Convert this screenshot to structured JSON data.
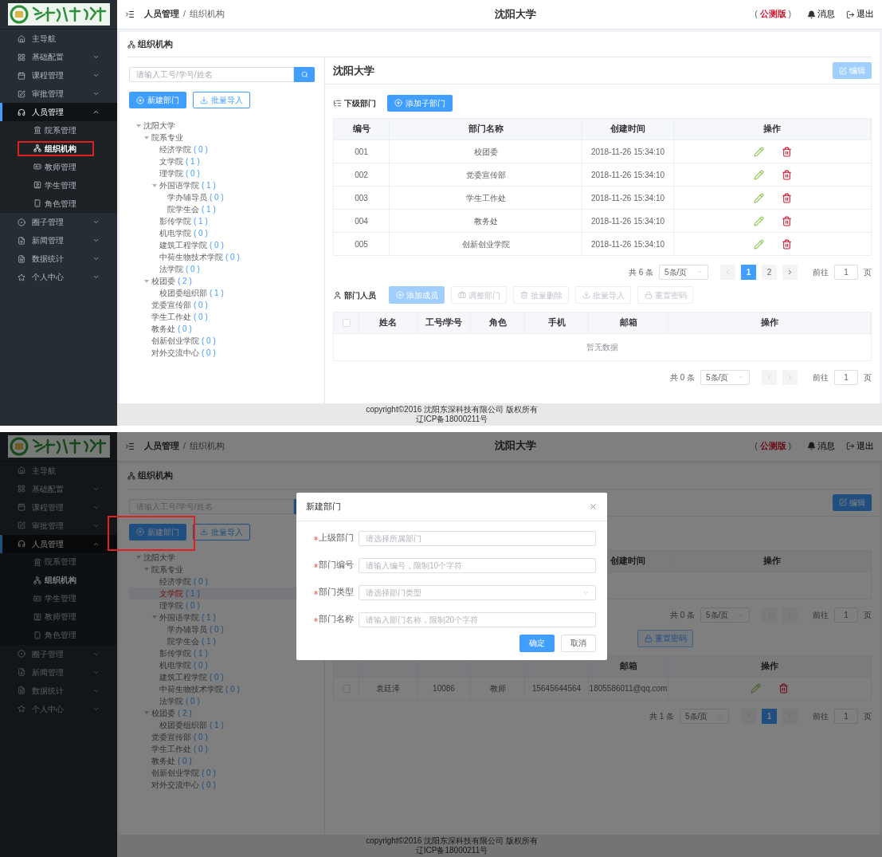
{
  "screens": [
    {
      "sidebar": {
        "items": [
          {
            "label": "主导航",
            "kind": "link",
            "expanded": false
          },
          {
            "label": "基础配置",
            "kind": "submenu",
            "expanded": false
          },
          {
            "label": "课程管理",
            "kind": "submenu",
            "expanded": false
          },
          {
            "label": "审批管理",
            "kind": "submenu",
            "expanded": false
          },
          {
            "label": "人员管理",
            "kind": "submenu",
            "expanded": true,
            "children": [
              {
                "label": "院系管理",
                "selected": false,
                "annotated": false
              },
              {
                "label": "组织机构",
                "selected": true,
                "annotated": true
              },
              {
                "label": "教师管理",
                "selected": false,
                "annotated": false
              },
              {
                "label": "学生管理",
                "selected": false,
                "annotated": false
              },
              {
                "label": "角色管理",
                "selected": false,
                "annotated": false
              }
            ]
          },
          {
            "label": "圈子管理",
            "kind": "submenu",
            "expanded": false
          },
          {
            "label": "新闻管理",
            "kind": "submenu",
            "expanded": false
          },
          {
            "label": "数据统计",
            "kind": "submenu",
            "expanded": false
          },
          {
            "label": "个人中心",
            "kind": "submenu",
            "expanded": false
          }
        ]
      },
      "header": {
        "breadcrumb": [
          "人员管理",
          "组织机构"
        ],
        "separator": "/",
        "title": "沈阳大学",
        "edition": "( **公测版** )",
        "messages": "消息",
        "logout": "退出"
      },
      "card_title": "组织机构",
      "search": {
        "placeholder": "请输入工号/学号/姓名"
      },
      "left_buttons": [
        {
          "label": "新建部门",
          "kind": "primary",
          "annotated": false
        },
        {
          "label": "批量导入",
          "kind": "default",
          "annotated": false
        }
      ],
      "tree": [
        {
          "name": "沈阳大学",
          "expanded": true,
          "selected": false,
          "children": [
            {
              "name": "院系专业",
              "expanded": true,
              "selected": false,
              "children": [
                {
                  "name": "经济学院",
                  "count": "( 0 )",
                  "selected": false
                },
                {
                  "name": "文学院",
                  "count": "( 1 )",
                  "selected": false
                },
                {
                  "name": "理学院",
                  "count": "( 0 )",
                  "selected": false
                },
                {
                  "name": "外国语学院",
                  "count": "( 1 )",
                  "expanded": true,
                  "selected": false,
                  "children": [
                    {
                      "name": "学办辅导员",
                      "count": "( 0 )",
                      "selected": false
                    },
                    {
                      "name": "院学生会",
                      "count": "( 1 )",
                      "selected": false
                    }
                  ]
                },
                {
                  "name": "影传学院",
                  "count": "( 1 )",
                  "selected": false
                },
                {
                  "name": "机电学院",
                  "count": "( 0 )",
                  "selected": false
                },
                {
                  "name": "建筑工程学院",
                  "count": "( 0 )",
                  "selected": false
                },
                {
                  "name": "中荷生物技术学院",
                  "count": "( 0 )",
                  "selected": false
                },
                {
                  "name": "法学院",
                  "count": "( 0 )",
                  "selected": false
                }
              ]
            },
            {
              "name": "校团委",
              "count": "( 2 )",
              "expanded": true,
              "selected": false,
              "children": [
                {
                  "name": "校团委组织部",
                  "count": "( 1 )",
                  "selected": false
                }
              ]
            },
            {
              "name": "党委宣传部",
              "count": "( 0 )",
              "selected": false
            },
            {
              "name": "学生工作处",
              "count": "( 0 )",
              "selected": false
            },
            {
              "name": "教务处",
              "count": "( 0 )",
              "selected": false
            },
            {
              "name": "创新创业学院",
              "count": "( 0 )",
              "selected": false
            },
            {
              "name": "对外交流中心",
              "count": "( 0 )",
              "selected": false
            }
          ]
        }
      ],
      "detail": {
        "title": "沈阳大学",
        "edit_button": {
          "label": "编辑",
          "disabled": true
        },
        "sub_label": "下级部门",
        "add_button": "添加子部门",
        "sub_table": {
          "columns": [
            "编号",
            "部门名称",
            "创建时间",
            "操作"
          ],
          "rows": [
            [
              "001",
              "校团委",
              "2018-11-26 15:34:10"
            ],
            [
              "002",
              "党委宣传部",
              "2018-11-26 15:34:10"
            ],
            [
              "003",
              "学生工作处",
              "2018-11-26 15:34:10"
            ],
            [
              "004",
              "教务处",
              "2018-11-26 15:34:10"
            ],
            [
              "005",
              "创新创业学院",
              "2018-11-26 15:34:10"
            ]
          ]
        },
        "sub_pager": {
          "total": "共 6 条",
          "page_size": "5条/页",
          "pages": [
            {
              "label": "1",
              "selected": true
            },
            {
              "label": "2",
              "selected": false
            }
          ],
          "prev_disabled": true,
          "next_disabled": false,
          "goto_label": "前往",
          "goto_value": "1",
          "goto_suffix": "页"
        },
        "member_label": "部门人员",
        "member_actions": [
          {
            "label": "添加成员",
            "kind": "primary",
            "disabled": true
          },
          {
            "label": "调整部门",
            "kind": "default",
            "disabled": true
          },
          {
            "label": "批量删除",
            "kind": "default",
            "disabled": true
          },
          {
            "label": "批量导入",
            "kind": "default",
            "disabled": true
          },
          {
            "label": "重置密码",
            "kind": "default",
            "disabled": true
          }
        ],
        "member_table": {
          "header_checkbox": {
            "checked": false
          },
          "columns": [
            "姓名",
            "工号/学号",
            "角色",
            "手机",
            "邮箱",
            "操作"
          ],
          "empty_text": "暂无数据"
        },
        "member_pager": {
          "total": "共 0 条",
          "page_size": "5条/页",
          "prev_disabled": true,
          "next_disabled": true,
          "goto_label": "前往",
          "goto_value": "1",
          "goto_suffix": "页"
        }
      },
      "footer": [
        "copyright©2016 沈阳东深科技有限公司 版权所有",
        "辽ICP备18000211号"
      ]
    },
    {
      "sidebar": {
        "items": [
          {
            "label": "主导航",
            "kind": "link",
            "expanded": false
          },
          {
            "label": "基础配置",
            "kind": "submenu",
            "expanded": false
          },
          {
            "label": "课程管理",
            "kind": "submenu",
            "expanded": false
          },
          {
            "label": "审批管理",
            "kind": "submenu",
            "expanded": false
          },
          {
            "label": "人员管理",
            "kind": "submenu",
            "expanded": true,
            "children": [
              {
                "label": "院系管理",
                "selected": false,
                "annotated": false
              },
              {
                "label": "组织机构",
                "selected": true,
                "annotated": false
              },
              {
                "label": "学生管理",
                "selected": false,
                "annotated": false
              },
              {
                "label": "教师管理",
                "selected": false,
                "annotated": false
              },
              {
                "label": "角色管理",
                "selected": false,
                "annotated": false
              }
            ]
          },
          {
            "label": "圈子管理",
            "kind": "submenu",
            "expanded": false
          },
          {
            "label": "新闻管理",
            "kind": "submenu",
            "expanded": false
          },
          {
            "label": "数据统计",
            "kind": "submenu",
            "expanded": false
          },
          {
            "label": "个人中心",
            "kind": "submenu",
            "expanded": false
          }
        ]
      },
      "header": {
        "breadcrumb": [
          "人员管理",
          "组织机构"
        ],
        "separator": "/",
        "title": "沈阳大学",
        "edition": "( **公测版** )",
        "messages": "消息",
        "logout": "退出"
      },
      "card_title": "组织机构",
      "search": {
        "placeholder": "请输入工号/学号/姓名"
      },
      "left_buttons": [
        {
          "label": "新建部门",
          "kind": "primary",
          "annotated": true
        },
        {
          "label": "批量导入",
          "kind": "default",
          "annotated": false
        }
      ],
      "tree": [
        {
          "name": "沈阳大学",
          "expanded": true,
          "selected": false,
          "children": [
            {
              "name": "院系专业",
              "expanded": true,
              "selected": false,
              "children": [
                {
                  "name": "经济学院",
                  "count": "( 0 )",
                  "selected": false
                },
                {
                  "name": "文学院",
                  "count": "( 1 )",
                  "selected": true
                },
                {
                  "name": "理学院",
                  "count": "( 0 )",
                  "selected": false
                },
                {
                  "name": "外国语学院",
                  "count": "( 1 )",
                  "expanded": true,
                  "selected": false,
                  "children": [
                    {
                      "name": "学办辅导员",
                      "count": "( 0 )",
                      "selected": false
                    },
                    {
                      "name": "院学生会",
                      "count": "( 1 )",
                      "selected": false
                    }
                  ]
                },
                {
                  "name": "影传学院",
                  "count": "( 1 )",
                  "selected": false
                },
                {
                  "name": "机电学院",
                  "count": "( 0 )",
                  "selected": false
                },
                {
                  "name": "建筑工程学院",
                  "count": "( 0 )",
                  "selected": false
                },
                {
                  "name": "中荷生物技术学院",
                  "count": "( 0 )",
                  "selected": false
                },
                {
                  "name": "法学院",
                  "count": "( 0 )",
                  "selected": false
                }
              ]
            },
            {
              "name": "校团委",
              "count": "( 2 )",
              "expanded": true,
              "selected": false,
              "children": [
                {
                  "name": "校团委组织部",
                  "count": "( 1 )",
                  "selected": false
                }
              ]
            },
            {
              "name": "党委宣传部",
              "count": "( 0 )",
              "selected": false
            },
            {
              "name": "学生工作处",
              "count": "( 0 )",
              "selected": false
            },
            {
              "name": "教务处",
              "count": "( 0 )",
              "selected": false
            },
            {
              "name": "创新创业学院",
              "count": "( 0 )",
              "selected": false
            },
            {
              "name": "对外交流中心",
              "count": "( 0 )",
              "selected": false
            }
          ]
        }
      ],
      "detail": {
        "edit_button": {
          "label": "编辑",
          "disabled": false
        },
        "sub_table": {
          "columns": [
            "",
            "",
            "创建时间",
            "操作"
          ]
        },
        "sub_pager": {
          "total": "共 0 条",
          "page_size": "5条/页",
          "prev_disabled": true,
          "next_disabled": true,
          "goto_label": "前往",
          "goto_value": "1",
          "goto_suffix": "页"
        },
        "member_actions": [
          {
            "label": "重置密码",
            "kind": "default",
            "disabled": false
          }
        ],
        "member_table": {
          "columns": [
            "",
            "",
            "",
            "",
            "邮箱",
            "操作"
          ],
          "rows": [
            {
              "checked": false,
              "cells": [
                "袁廷泽",
                "10086",
                "教师",
                "15645644564",
                "1805586011@qq.com"
              ]
            }
          ]
        },
        "member_pager": {
          "total": "共 1 条",
          "page_size": "5条/页",
          "pages": [
            {
              "label": "1",
              "selected": true
            }
          ],
          "prev_disabled": true,
          "next_disabled": true,
          "goto_label": "前往",
          "goto_value": "1",
          "goto_suffix": "页"
        }
      },
      "footer": [
        "copyright©2016 沈阳东深科技有限公司 版权所有",
        "辽ICP备18000211号"
      ],
      "modal": {
        "title": "新建部门",
        "fields": [
          {
            "label": "上级部门",
            "kind": "input",
            "required": true,
            "placeholder": "请选择所属部门"
          },
          {
            "label": "部门编号",
            "kind": "input",
            "required": true,
            "placeholder": "请输入编号，限制10个字符"
          },
          {
            "label": "部门类型",
            "kind": "select",
            "required": true,
            "placeholder": "请选择部门类型"
          },
          {
            "label": "部门名称",
            "kind": "input",
            "required": true,
            "placeholder": "请输入部门名称，限制20个字符"
          }
        ],
        "buttons": [
          {
            "label": "确定",
            "kind": "primary"
          },
          {
            "label": "取消",
            "kind": "default"
          }
        ]
      }
    }
  ]
}
